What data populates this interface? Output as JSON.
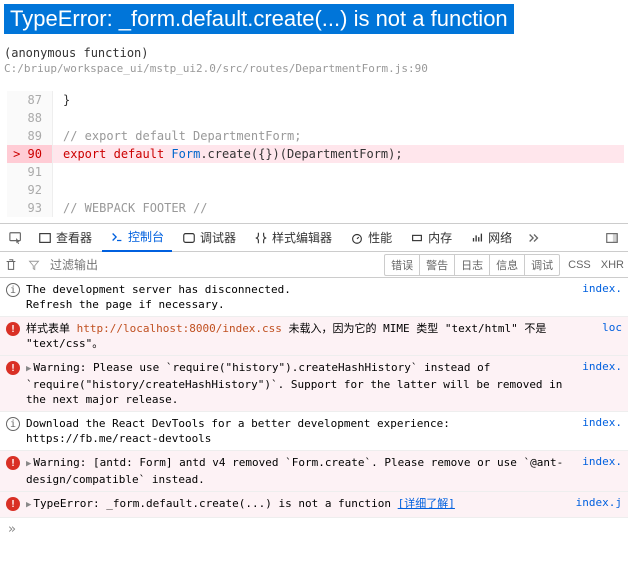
{
  "error": {
    "title": "TypeError: _form.default.create(...) is not a function",
    "anon": "(anonymous function)",
    "path": "C:/briup/workspace_ui/mstp_ui2.0/src/routes/DepartmentForm.js:90"
  },
  "code": {
    "l87": {
      "num": "87",
      "text": "}"
    },
    "l88": {
      "num": "88",
      "text": ""
    },
    "l89": {
      "num": "89",
      "text": "// export default DepartmentForm;"
    },
    "l90": {
      "num": "90",
      "export": "export",
      "default": "default",
      "form": "Form",
      "rest": ".create({})(DepartmentForm);"
    },
    "l91": {
      "num": "91",
      "text": ""
    },
    "l92": {
      "num": "92",
      "text": ""
    },
    "l93": {
      "num": "93",
      "text": "// WEBPACK FOOTER //"
    }
  },
  "tabs": {
    "inspector": "查看器",
    "console": "控制台",
    "debugger": "调试器",
    "style": "样式编辑器",
    "perf": "性能",
    "memory": "内存",
    "network": "网络"
  },
  "filter": {
    "placeholder": "过滤输出",
    "pills": {
      "error": "错误",
      "warn": "警告",
      "log": "日志",
      "info": "信息",
      "debug": "调试"
    },
    "css": "CSS",
    "xhr": "XHR"
  },
  "msgs": {
    "m1": {
      "text": "The development server has disconnected.\nRefresh the page if necessary.",
      "src": "index."
    },
    "m2": {
      "pre": "样式表单 ",
      "url": "http://localhost:8000/index.css",
      "rest": " 未载入，因为它的 MIME 类型 \"text/html\" 不是 \"text/css\"。",
      "src": "loc"
    },
    "m3": {
      "text": "Warning: Please use `require(\"history\").createHashHistory` instead of `require(\"history/createHashHistory\")`. Support for the latter will be removed in the next major release.",
      "src": "index."
    },
    "m4": {
      "pre": "Download the React DevTools for a better development experience: ",
      "url": "https://fb.me/react-devtools",
      "src": "index."
    },
    "m5": {
      "text": "Warning: [antd: Form] antd v4 removed `Form.create`. Please remove or use `@ant-design/compatible` instead.",
      "src": "index."
    },
    "m6": {
      "text": "TypeError: _form.default.create(...) is not a function",
      "link": "[详细了解]",
      "src": "index.j"
    }
  },
  "prompt": "»"
}
